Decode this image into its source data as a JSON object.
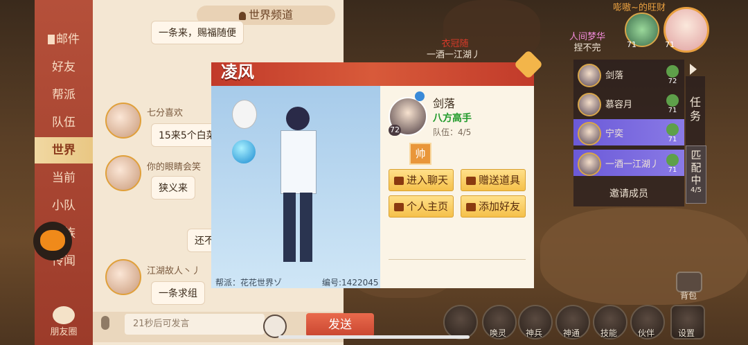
{
  "chat": {
    "tabs": [
      "邮件",
      "好友",
      "帮派",
      "队伍",
      "世界",
      "当前",
      "小队",
      "家族",
      "传闻"
    ],
    "active_tab": "世界",
    "header_title": "世界频道",
    "friends_circle_label": "朋友圈",
    "messages": [
      {
        "name": "",
        "text": "一条来，赐福随便"
      },
      {
        "name": "七分喜欢",
        "text": "15来5个白菜"
      },
      {
        "name": "你的眼睛会笑",
        "text": "狭义来"
      },
      {
        "name": "",
        "text": "还不"
      },
      {
        "name": "江湖故人丶丿",
        "text": "一条求组"
      }
    ],
    "input_placeholder": "21秒后可发言",
    "send_label": "发送"
  },
  "modal": {
    "title": "凌风",
    "faction_text": "帮派：花花世界ゾ",
    "id_text": "编号:1422045",
    "profile": {
      "name": "剑落",
      "level": "72",
      "title": "八方高手",
      "team": "队伍：4/5",
      "badge": "帅"
    },
    "actions": {
      "chat": "进入聊天",
      "gift": "赠送道具",
      "homepage": "个人主页",
      "add_friend": "添加好友"
    }
  },
  "world_tags": {
    "center_line1": "衣冠随",
    "center_line2": "一酒一江湖丿",
    "right_line1": "人间梦华",
    "right_line2": "捏不完",
    "top_right": "嘭嗷~的旺财"
  },
  "team_panel": {
    "members": [
      {
        "name": "剑落",
        "level": "72"
      },
      {
        "name": "慕容月",
        "level": "71"
      },
      {
        "name": "宁奕",
        "level": "71"
      },
      {
        "name": "一酒一江湖丿",
        "level": "71"
      }
    ],
    "invite_label": "邀请成员",
    "task_tab": "任务",
    "match_tab": "匹配中",
    "match_count": "4/5",
    "top_avatar_level": "71",
    "top_avatar2_level": "71"
  },
  "bottom_bar": {
    "bag_label": "背包",
    "items": [
      "唤灵",
      "神兵",
      "神通",
      "技能",
      "伙伴",
      "设置"
    ]
  }
}
